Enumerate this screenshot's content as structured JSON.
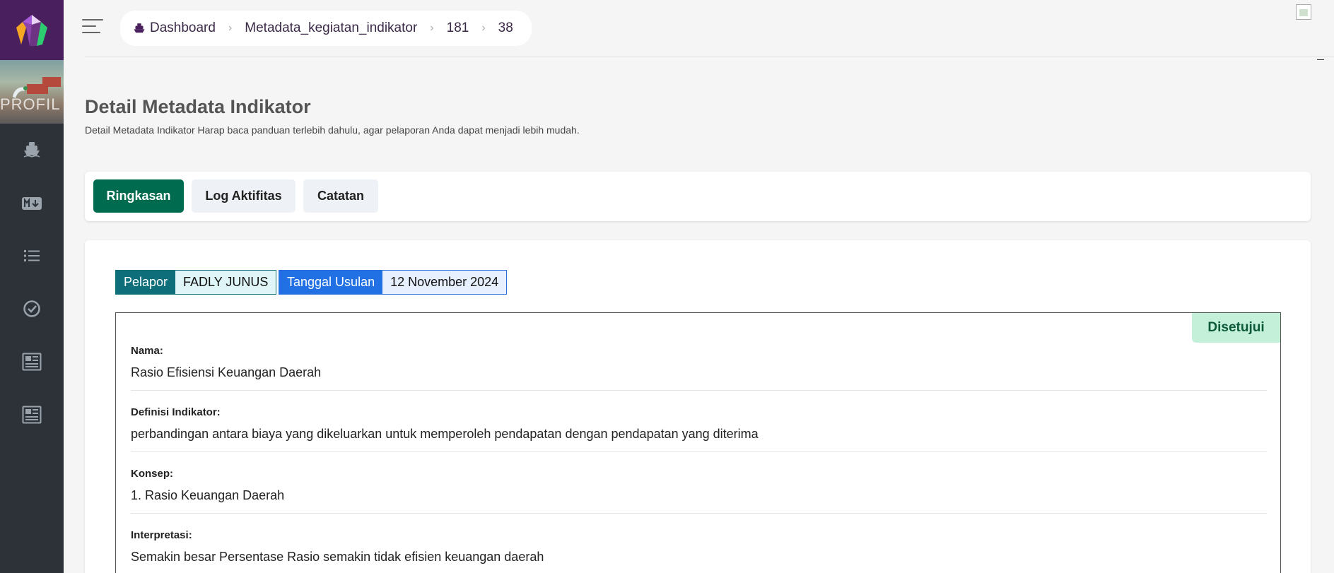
{
  "sidebar": {
    "banner_text": "PROFIL",
    "items": [
      {
        "icon": "ship-icon"
      },
      {
        "icon": "markdown-icon"
      },
      {
        "icon": "list-icon"
      },
      {
        "icon": "check-circle-icon"
      },
      {
        "icon": "newspaper-icon"
      },
      {
        "icon": "newspaper-icon"
      }
    ]
  },
  "breadcrumb": {
    "items": [
      "Dashboard",
      "Metadata_kegiatan_indikator",
      "181",
      "38"
    ]
  },
  "header": {
    "title": "Detail Metadata Indikator",
    "subtitle": "Detail Metadata Indikator Harap baca panduan terlebih dahulu, agar pelaporan Anda dapat menjadi lebih mudah."
  },
  "tabs": [
    {
      "label": "Ringkasan",
      "active": true
    },
    {
      "label": "Log Aktifitas",
      "active": false
    },
    {
      "label": "Catatan",
      "active": false
    }
  ],
  "badges": {
    "reporter_label": "Pelapor",
    "reporter_value": "FADLY JUNUS",
    "date_label": "Tanggal Usulan",
    "date_value": "12 November 2024"
  },
  "status": "Disetujui",
  "fields": [
    {
      "label": "Nama:",
      "value": "Rasio Efisiensi Keuangan Daerah"
    },
    {
      "label": "Definisi Indikator:",
      "value": "perbandingan antara biaya yang dikeluarkan untuk memperoleh pendapatan dengan pendapatan yang diterima"
    },
    {
      "label": "Konsep:",
      "value": "1. Rasio Keuangan Daerah"
    },
    {
      "label": "Interpretasi:",
      "value": "Semakin besar Persentase Rasio semakin tidak efisien keuangan daerah"
    }
  ],
  "colors": {
    "sidebar_bg": "#2c3238",
    "logo_bg": "#4a1f5e",
    "tab_active": "#006b4f",
    "status_bg": "#c4f0da",
    "badge_teal": "#0e6f7b",
    "badge_blue": "#2170e4"
  }
}
